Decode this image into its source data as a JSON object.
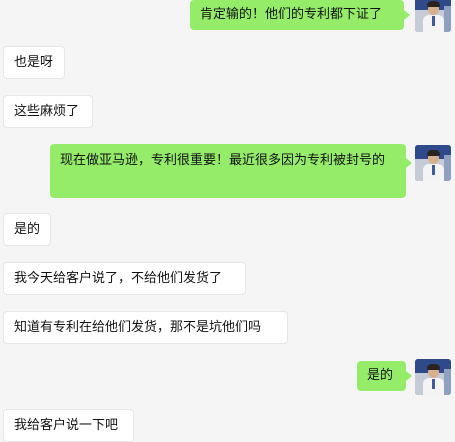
{
  "messages": [
    {
      "side": "out",
      "text": "肯定输的！他们的专利都下证了"
    },
    {
      "side": "in",
      "text": "也是呀"
    },
    {
      "side": "in",
      "text": "这些麻烦了"
    },
    {
      "side": "out",
      "text": "现在做亚马逊，专利很重要！最近很多因为专利被封号的"
    },
    {
      "side": "in",
      "text": "是的"
    },
    {
      "side": "in",
      "text": "我今天给客户说了，不给他们发货了"
    },
    {
      "side": "in",
      "text": "知道有专利在给他们发货，那不是坑他们吗"
    },
    {
      "side": "out",
      "text": "是的"
    },
    {
      "side": "in",
      "text": "我给客户说一下吧"
    }
  ],
  "colors": {
    "background": "#f5f5f5",
    "outgoing_bubble": "#95ec69",
    "incoming_bubble": "#ffffff"
  },
  "avatar_icon": "user-avatar-photo"
}
